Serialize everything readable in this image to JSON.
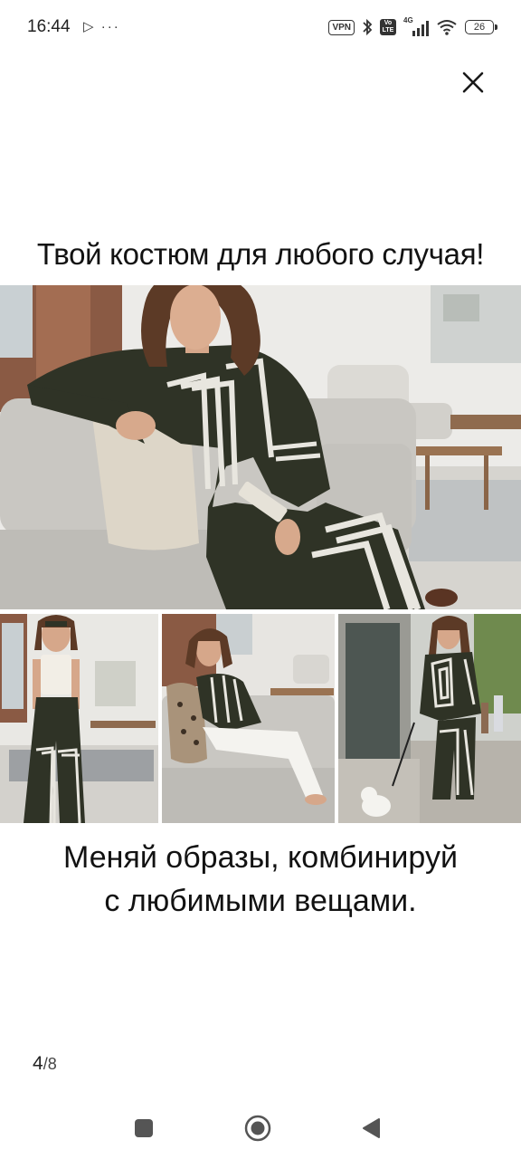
{
  "status_bar": {
    "time": "16:44",
    "left_icons": "⊳ …",
    "vpn": "VPN",
    "lte": "Vo LTE",
    "network": "4G",
    "battery": "26"
  },
  "ad": {
    "headline": "Твой костюм для любого случая!",
    "caption_line1": "Меняй образы, комбинируй",
    "caption_line2": "с любимыми вещами."
  },
  "pager": {
    "current": "4",
    "separator": "/",
    "total": "8"
  },
  "colors": {
    "outfit": "#2f3326",
    "stripe": "#e8e6df",
    "sofa": "#c9c7c2",
    "wall": "#ecebe8"
  },
  "icons": [
    "play-icon",
    "more-dots-icon",
    "bluetooth-icon",
    "wifi-icon",
    "close-icon",
    "home-icon",
    "recents-icon",
    "back-icon"
  ]
}
